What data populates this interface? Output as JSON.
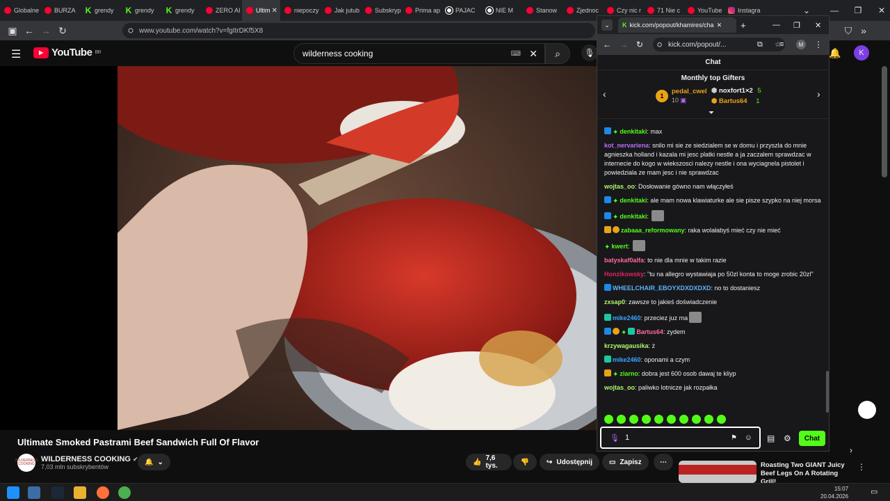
{
  "browser": {
    "tabs": [
      {
        "label": "Globalne",
        "icon": "yt"
      },
      {
        "label": "BURZA",
        "icon": "yt"
      },
      {
        "label": "grendy",
        "icon": "k"
      },
      {
        "label": "grendy",
        "icon": "k"
      },
      {
        "label": "grendy",
        "icon": "k"
      },
      {
        "label": "ZERO AI",
        "icon": "yt"
      },
      {
        "label": "Ultim",
        "icon": "yt",
        "active": true
      },
      {
        "label": "niepoczy",
        "icon": "yt"
      },
      {
        "label": "Jak jutub",
        "icon": "yt"
      },
      {
        "label": "Subskryp",
        "icon": "yt"
      },
      {
        "label": "Prima ap",
        "icon": "yt"
      },
      {
        "label": "PAJAC",
        "icon": "rec"
      },
      {
        "label": "NIE M",
        "icon": "rec"
      },
      {
        "label": "Stanow",
        "icon": "yt"
      },
      {
        "label": "Zjednoc",
        "icon": "yt"
      },
      {
        "label": "Czy nic r",
        "icon": "yt"
      },
      {
        "label": "71 Nie c",
        "icon": "yt"
      },
      {
        "label": "YouTube",
        "icon": "yt"
      },
      {
        "label": "Instagra",
        "icon": "ig"
      }
    ],
    "url": "www.youtube.com/watch?v=fgItrDKf5X8"
  },
  "youtube": {
    "logo": "YouTube",
    "region": "BR",
    "search_value": "wilderness cooking",
    "video_title": "Ultimate Smoked Pastrami Beef Sandwich Full Of Flavor",
    "channel_name": "WILDERNESS COOKING",
    "subscribers": "7,03 mln subskrybentów",
    "avatar_text": "WILDERNESS COOKING",
    "likes": "7,6 tys.",
    "share_label": "Udostępnij",
    "save_label": "Zapisz",
    "rec_title": "Roasting Two GIANT Juicy Beef Legs On A Rotating Grill!",
    "profile_initial": "K"
  },
  "kick": {
    "tab_label": "kick.com/popout/khamires/cha",
    "url": "kick.com/popout/...",
    "profile_initial": "M",
    "chat_title": "Chat",
    "gifters_title": "Monthly top Gifters",
    "gifters": [
      {
        "rank": "1",
        "name": "pedal_cwel",
        "count": "10"
      },
      {
        "name": "noxfort1×2",
        "count": "5"
      },
      {
        "name": "Bartus64",
        "count": "1"
      }
    ],
    "messages": [
      {
        "user": "denkitaki",
        "color": "#53fc18",
        "badges": [
          "prime",
          "star"
        ],
        "text": "max"
      },
      {
        "user": "kot_nervariena",
        "color": "#b96ff5",
        "badges": [],
        "text": "snilo mi sie ze siedzialem se w domu i przyszla do mnie agnieszka holland i kazala mi jesc platki nestle a ja zaczalem sprawdzac w internecie do kogo w wiekszosci nalezy nestle i ona wyciagnela pistolet i powiedziala ze mam jesc i nie sprawdzac"
      },
      {
        "user": "wojtas_oo",
        "color": "#b0f56b",
        "badges": [],
        "text": "Dosłowanie gówno nam włączyłeś"
      },
      {
        "user": "denkitaki",
        "color": "#53fc18",
        "badges": [
          "prime",
          "star"
        ],
        "text": "ale mam nowa klawiaturke ale sie pisze szypko na niej morsa"
      },
      {
        "user": "denkitaki",
        "color": "#53fc18",
        "badges": [
          "prime",
          "star"
        ],
        "text": "",
        "emote": true
      },
      {
        "user": "zabaaa_reformowany",
        "color": "#53fc18",
        "badges": [
          "crown",
          "sub"
        ],
        "text": "raka wolałabyś mieć czy nie mieć"
      },
      {
        "user": "kwert",
        "color": "#53fc18",
        "badges": [
          "star"
        ],
        "text": "",
        "emote": true
      },
      {
        "user": "batyskaf0alfa",
        "color": "#ff6b9d",
        "badges": [],
        "text": "to nie dla mnie w takim razie"
      },
      {
        "user": "Honzikowsky",
        "color": "#e0245e",
        "badges": [],
        "text": "\"tu na allegro wystawiaja po 50zl konta to moge zrobic 20zl\""
      },
      {
        "user": "WHEELCHAIR_EBOYXDXDXDXD",
        "color": "#5fb3f9",
        "badges": [
          "prime"
        ],
        "text": "no to dostaniesz"
      },
      {
        "user": "zxsap0",
        "color": "#b0f56b",
        "badges": [],
        "text": "zawsze to jakieś doświadczenie"
      },
      {
        "user": "mike2460",
        "color": "#3aa3ff",
        "badges": [
          "gift"
        ],
        "text": "przeciez juz ma",
        "emote": true
      },
      {
        "user": "Bartus64",
        "color": "#ff6b9d",
        "badges": [
          "prime",
          "sub",
          "star",
          "gift"
        ],
        "text": "zydem"
      },
      {
        "user": "krzywagausika",
        "color": "#b0f56b",
        "badges": [],
        "text": "ż"
      },
      {
        "user": "mike2460",
        "color": "#3aa3ff",
        "badges": [
          "gift"
        ],
        "text": "oponami a czym"
      },
      {
        "user": "ziarno",
        "color": "#53fc18",
        "badges": [
          "crown",
          "star"
        ],
        "text": "dobra jest 600 osob dawaj te kliyp"
      },
      {
        "user": "wojtas_oo",
        "color": "#b0f56b",
        "badges": [],
        "text": "paliwko lotnicze jak rozpałka"
      }
    ],
    "input_value": "1",
    "send_label": "Chat"
  },
  "taskbar": {
    "time": "15:07",
    "date": "20.04.2026"
  }
}
